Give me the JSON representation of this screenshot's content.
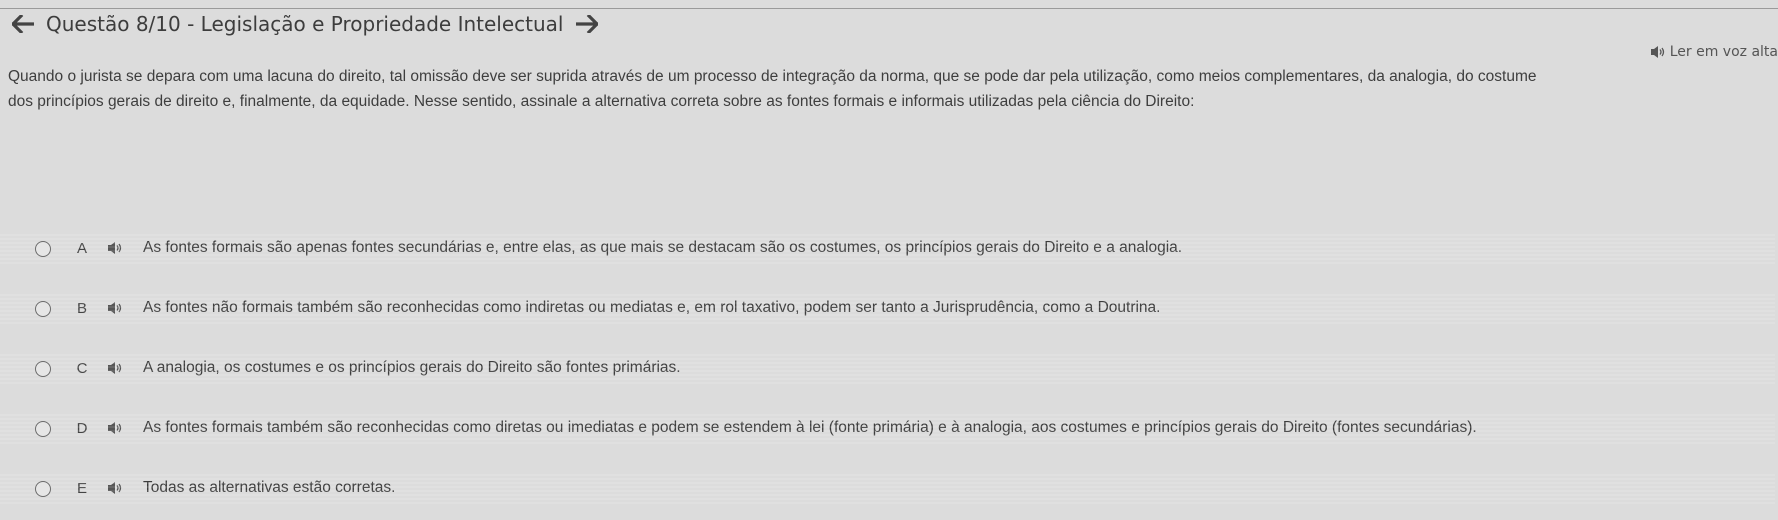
{
  "header": {
    "title": "Questão 8/10 - Legislação e Propriedade Intelectual",
    "prev_icon": "arrow-left-icon",
    "next_icon": "arrow-right-icon"
  },
  "read_aloud": {
    "label": "Ler em voz alta",
    "icon": "speaker-icon"
  },
  "question": {
    "lines": [
      "Quando o jurista se depara com uma lacuna do direito, tal omissão deve ser suprida através de um processo de integração da norma, que se pode dar pela utilização, como meios complementares, da analogia, do costume",
      "dos princípios gerais de direito e, finalmente, da equidade.  Nesse sentido, assinale a alternativa correta sobre as fontes formais e informais utilizadas pela ciência do Direito:"
    ]
  },
  "options": [
    {
      "letter": "A",
      "text": "As fontes formais são apenas fontes secundárias e, entre elas, as que mais se destacam são os costumes, os princípios gerais do Direito e a analogia."
    },
    {
      "letter": "B",
      "text": "As fontes não formais também são reconhecidas como indiretas ou mediatas e, em rol taxativo, podem ser tanto a Jurisprudência, como a Doutrina."
    },
    {
      "letter": "C",
      "text": "A analogia, os costumes e os princípios gerais do Direito são fontes primárias."
    },
    {
      "letter": "D",
      "text": "As fontes formais também são reconhecidas como diretas ou imediatas e podem se estendem à lei (fonte primária) e à analogia, aos costumes e princípios gerais do Direito (fontes secundárias)."
    },
    {
      "letter": "E",
      "text": "Todas as alternativas estão corretas."
    }
  ],
  "colors": {
    "background": "#dcdcdc",
    "text": "#3c3c3c"
  }
}
